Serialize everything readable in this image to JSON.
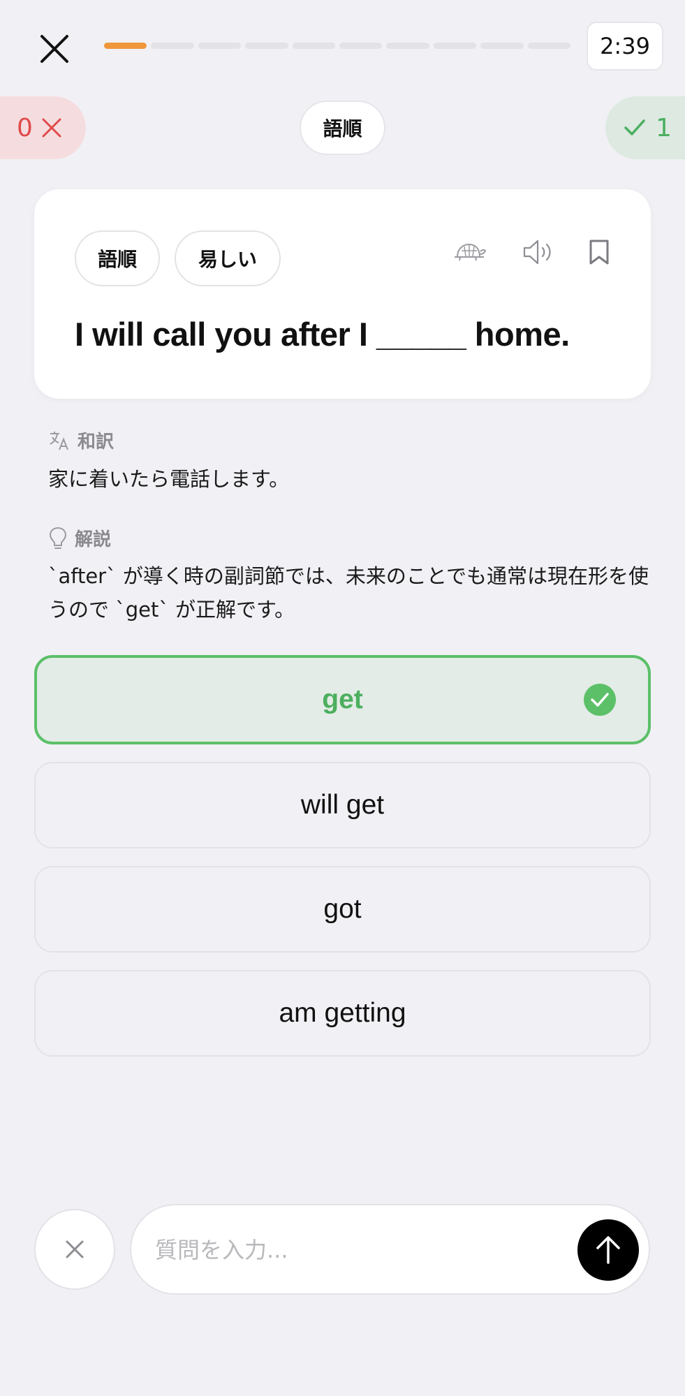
{
  "header": {
    "timer": "2:39",
    "progress": {
      "total_segments": 10,
      "completed_segments": 1,
      "color": "#f0973b"
    }
  },
  "score": {
    "wrong_count": "0",
    "correct_count": "1"
  },
  "category_label": "語順",
  "card": {
    "tags": [
      "語順",
      "易しい"
    ],
    "question": "I will call you after I _____ home."
  },
  "translation": {
    "heading": "和訳",
    "text": "家に着いたら電話します。"
  },
  "explanation": {
    "heading": "解説",
    "text": "`after` が導く時の副詞節では、未来のことでも通常は現在形を使うので `get` が正解です。"
  },
  "options": [
    {
      "label": "get",
      "state": "correct"
    },
    {
      "label": "will get",
      "state": "default"
    },
    {
      "label": "got",
      "state": "default"
    },
    {
      "label": "am getting",
      "state": "default"
    }
  ],
  "chat": {
    "placeholder": "質問を入力...",
    "value": ""
  },
  "colors": {
    "accent_orange": "#f0973b",
    "correct_green": "#5cc069",
    "wrong_red": "#e04a4a",
    "background": "#f1f1f5"
  }
}
